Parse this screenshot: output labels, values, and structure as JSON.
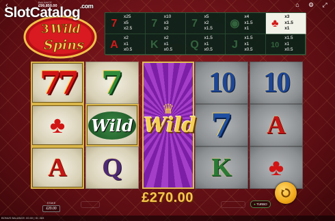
{
  "topbar": {
    "balance_label": "BALANCE",
    "balance_value": "£99,850.00",
    "icons": [
      "home-icon",
      "gear-icon",
      "fullscreen-icon"
    ]
  },
  "watermark": {
    "text_a": "Slot",
    "text_b": "Catalog",
    "text_c": ".com"
  },
  "logo": {
    "line1": "3",
    "line2": "Wild",
    "line3": "Spins"
  },
  "paytable": [
    {
      "symbol": "red-seven",
      "glyph": "7",
      "pays": [
        "x25",
        "x5",
        "x2.5"
      ],
      "highlight": false,
      "red": true
    },
    {
      "symbol": "green-seven",
      "glyph": "7",
      "pays": [
        "x10",
        "x3",
        "x2"
      ],
      "highlight": false,
      "red": false
    },
    {
      "symbol": "blue-seven",
      "glyph": "7",
      "pays": [
        "x5",
        "x2",
        "x1.5"
      ],
      "highlight": false,
      "red": false
    },
    {
      "symbol": "melon",
      "glyph": "◉",
      "pays": [
        "x4",
        "x1.5",
        "x1"
      ],
      "highlight": false,
      "red": false
    },
    {
      "symbol": "cherry",
      "glyph": "♣",
      "pays": [
        "x3",
        "x1.5",
        "x1"
      ],
      "highlight": true,
      "red": true
    },
    {
      "symbol": "ace",
      "glyph": "A",
      "pays": [
        "x2",
        "x1",
        "x0.5"
      ],
      "highlight": false,
      "red": true
    },
    {
      "symbol": "king",
      "glyph": "K",
      "pays": [
        "x2",
        "x1",
        "x0.5"
      ],
      "highlight": false,
      "red": false
    },
    {
      "symbol": "queen",
      "glyph": "Q",
      "pays": [
        "x1.5",
        "x1",
        "x0.5"
      ],
      "highlight": false,
      "red": false
    },
    {
      "symbol": "jack",
      "glyph": "J",
      "pays": [
        "x1.5",
        "x1",
        "x0.5"
      ],
      "highlight": false,
      "red": false
    },
    {
      "symbol": "ten",
      "glyph": "10",
      "pays": [
        "x1.5",
        "x1",
        "x0.5"
      ],
      "highlight": false,
      "red": false
    }
  ],
  "reels": [
    {
      "style": "gold",
      "cells": [
        {
          "symbol": "red-seven",
          "glyph": "77",
          "cls": "sym-seven-red",
          "win": true
        },
        {
          "symbol": "cherry",
          "glyph": "♣",
          "cls": "sym-cherry",
          "win": true
        },
        {
          "symbol": "ace",
          "glyph": "A",
          "cls": "sym-letter-red",
          "win": true
        }
      ]
    },
    {
      "style": "gold",
      "cells": [
        {
          "symbol": "green-seven",
          "glyph": "7",
          "cls": "sym-seven-green",
          "win": false
        },
        {
          "symbol": "wild",
          "glyph": "Wild",
          "cls": "sym-wild-small",
          "win": true
        },
        {
          "symbol": "queen",
          "glyph": "Q",
          "cls": "sym-letter-purple",
          "win": false
        }
      ]
    },
    {
      "style": "dark",
      "cells": [
        {
          "symbol": "ten",
          "glyph": "10",
          "cls": "sym-ten",
          "win": false
        },
        {
          "symbol": "blue-seven",
          "glyph": "7",
          "cls": "sym-seven-blue",
          "win": false
        },
        {
          "symbol": "king",
          "glyph": "K",
          "cls": "sym-letter-green",
          "win": false
        }
      ]
    },
    {
      "style": "dark",
      "cells": [
        {
          "symbol": "ten",
          "glyph": "10",
          "cls": "sym-ten",
          "win": false
        },
        {
          "symbol": "ace",
          "glyph": "A",
          "cls": "sym-letter-red",
          "win": false
        },
        {
          "symbol": "cherry",
          "glyph": "♣",
          "cls": "sym-cherry",
          "win": false
        }
      ]
    }
  ],
  "expanded_wild": {
    "crown": "♛",
    "label": "Wild"
  },
  "win_amount": "£270.00",
  "stake": {
    "label": "STAKE",
    "value": "£20.00"
  },
  "turbo": {
    "label": "TURBO"
  },
  "footer": {
    "text": "BONUS BALANCE: £0.00 | ID: 283"
  },
  "colors": {
    "accent": "#f6c64e",
    "background": "#6a0f15",
    "wild": "#9a34c0"
  }
}
